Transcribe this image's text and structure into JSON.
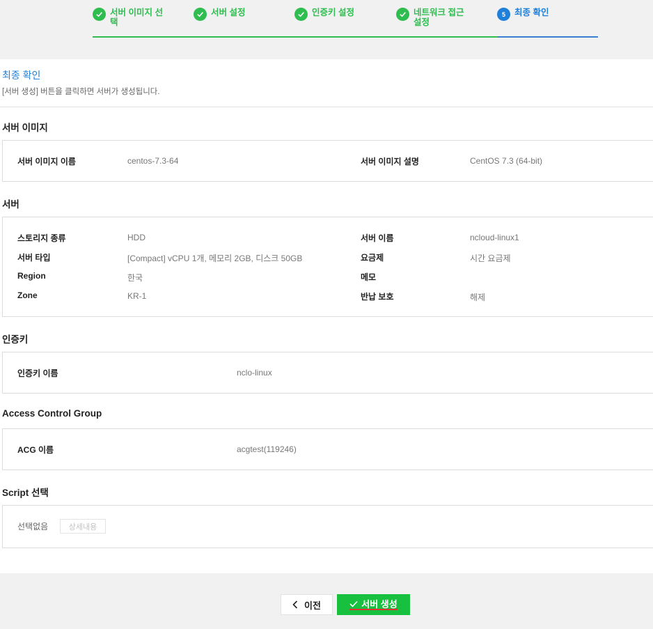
{
  "stepper": {
    "steps": [
      {
        "label_line1": "서버 이미지 선",
        "label_line2": "택",
        "state": "done"
      },
      {
        "label_line1": "서버 설정",
        "label_line2": "",
        "state": "done"
      },
      {
        "label_line1": "인증키 설정",
        "label_line2": "",
        "state": "done"
      },
      {
        "label_line1": "네트워크 접근",
        "label_line2": "설정",
        "state": "done"
      },
      {
        "label_line1": "최종 확인",
        "label_line2": "",
        "state": "current",
        "number": "5"
      }
    ]
  },
  "header": {
    "title": "최종 확인",
    "description": "[서버 생성] 버튼을 클릭하면 서버가 생성됩니다."
  },
  "server_image": {
    "section_title": "서버 이미지",
    "name_label": "서버 이미지 이름",
    "name_value": "centos-7.3-64",
    "desc_label": "서버 이미지 설명",
    "desc_value": "CentOS 7.3 (64-bit)"
  },
  "server": {
    "section_title": "서버",
    "storage_label": "스토리지 종류",
    "storage_value": "HDD",
    "type_label": "서버 타입",
    "type_value": "[Compact] vCPU 1개, 메모리 2GB, 디스크 50GB",
    "region_label": "Region",
    "region_value": "한국",
    "zone_label": "Zone",
    "zone_value": "KR-1",
    "name_label": "서버 이름",
    "name_value": "ncloud-linux1",
    "plan_label": "요금제",
    "plan_value": "시간 요금제",
    "memo_label": "메모",
    "memo_value": "",
    "protect_label": "반납 보호",
    "protect_value": "해제"
  },
  "auth_key": {
    "section_title": "인증키",
    "name_label": "인증키 이름",
    "name_value": "nclo-linux"
  },
  "acg": {
    "section_title": "Access Control Group",
    "name_label": "ACG 이름",
    "name_value": "acgtest(119246)"
  },
  "script": {
    "section_title": "Script 선택",
    "selection_value": "선택없음",
    "detail_button": "상세내용"
  },
  "footer": {
    "prev_label": "이전",
    "create_label": "서버 생성"
  },
  "colors": {
    "done": "#2fbd4f",
    "current": "#1f7fd9",
    "create_button": "#18c03f"
  }
}
